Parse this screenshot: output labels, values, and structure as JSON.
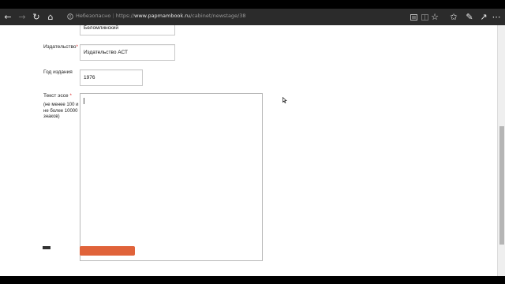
{
  "browser": {
    "url_insecure_label": "Небезопасно",
    "url_prefix": "https://",
    "url_host": "www.papmambook.ru",
    "url_path": "/cabinet/newstage/38",
    "icons": [
      "back-icon",
      "forward-icon",
      "refresh-icon",
      "home-icon",
      "insecure-icon",
      "reading-view-icon",
      "split-tab-icon",
      "favorite-icon",
      "favorites-icon",
      "pen-icon",
      "share-icon",
      "more-icon"
    ]
  },
  "form": {
    "author_value": "Беломлинский",
    "publisher_label": "Издательство",
    "publisher_required": "*",
    "publisher_value": "Издательство АСТ",
    "year_label": "Год издания",
    "year_value": "1976",
    "essay_label": "Текст эссе",
    "essay_required": "*",
    "essay_note": "(не менее 100 и не более 10000 знаков)",
    "essay_value": ""
  },
  "colors": {
    "toolbar": "#2b2b2b",
    "required": "#dd3333",
    "submit": "#e0633a"
  }
}
